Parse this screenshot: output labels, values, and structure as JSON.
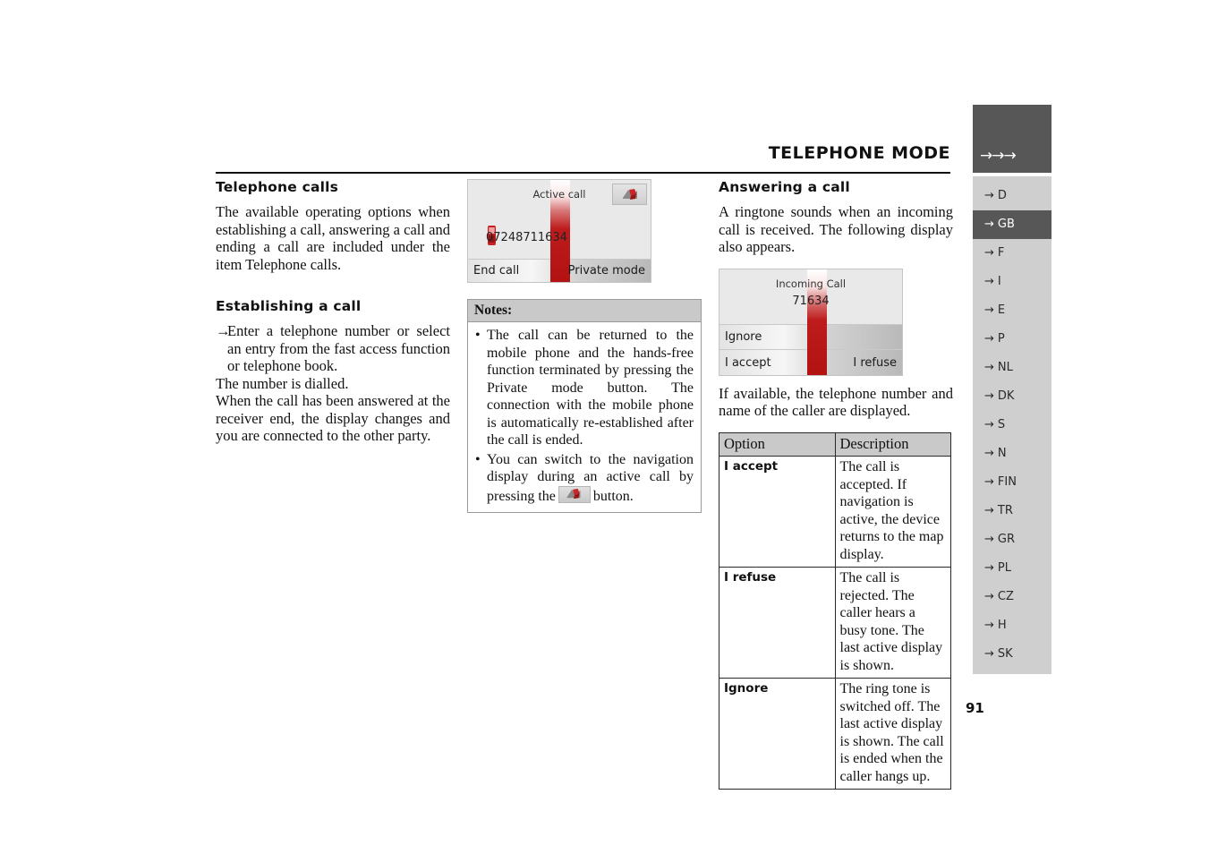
{
  "header": {
    "title": "TELEPHONE MODE",
    "arrows": "→→→"
  },
  "sidebar": {
    "active": "GB",
    "items": [
      {
        "label": "D"
      },
      {
        "label": "GB"
      },
      {
        "label": "F"
      },
      {
        "label": "I"
      },
      {
        "label": "E"
      },
      {
        "label": "P"
      },
      {
        "label": "NL"
      },
      {
        "label": "DK"
      },
      {
        "label": "S"
      },
      {
        "label": "N"
      },
      {
        "label": "FIN"
      },
      {
        "label": "TR"
      },
      {
        "label": "GR"
      },
      {
        "label": "PL"
      },
      {
        "label": "CZ"
      },
      {
        "label": "H"
      },
      {
        "label": "SK"
      }
    ],
    "arrow": "→"
  },
  "page_number": "91",
  "left_column": {
    "heading": "Telephone calls",
    "intro": "The available operating options when establishing a call, answering a call and ending a call are included under the item Telephone calls.",
    "subheading": "Establishing a call",
    "step_marker": "→",
    "step_text": "Enter a telephone number or select an entry from the fast access function or telephone book.",
    "after_step_1": "The number is dialled.",
    "after_step_2": "When the call has been answered at the receiver end, the display changes and you are connected to the other party."
  },
  "active_call_display": {
    "title": "Active call",
    "number": "07248711634",
    "left_button": "End call",
    "right_button": "Private mode",
    "nav_icon": "navigation-map-icon",
    "phone_icon": "mobile-phone-icon"
  },
  "notes": {
    "heading": "Notes:",
    "bullet_char": "•",
    "items": [
      {
        "text": "The call can be returned to the mobile phone and the hands-free function terminated by pressing the Private mode button.",
        "text2": "The connection with the mobile phone is automatically re-established after the call is ended."
      },
      {
        "pre": "You can switch to the navigation display during an active call by pressing the",
        "post": "button.",
        "icon": "navigation-map-icon"
      }
    ]
  },
  "right_column": {
    "heading": "Answering a call",
    "intro": "A ringtone sounds when an incoming call is received. The following display also appears.",
    "after_image": "If available, the telephone number and name of the caller are displayed."
  },
  "incoming_call_display": {
    "title": "Incoming Call",
    "number": "71634",
    "ignore_label": "Ignore",
    "accept_label": "I accept",
    "refuse_label": "I refuse"
  },
  "option_table": {
    "headers": [
      "Option",
      "Description"
    ],
    "rows": [
      {
        "option": "I accept",
        "description": "The call is accepted. If navigation is active, the device returns to the map display."
      },
      {
        "option": "I refuse",
        "description": "The call is rejected. The caller hears a busy tone. The last active display is shown."
      },
      {
        "option": "Ignore",
        "description": "The ring tone is switched off. The last active display is shown. The call is ended when the caller hangs up."
      }
    ]
  },
  "colors": {
    "sidebar_bg": "#cfcfcf",
    "sidebar_active": "#575757",
    "header_block": "#575757",
    "device_bg": "#e9e9e9",
    "accent_red": "#b21212",
    "table_header": "#c9c9c9"
  }
}
